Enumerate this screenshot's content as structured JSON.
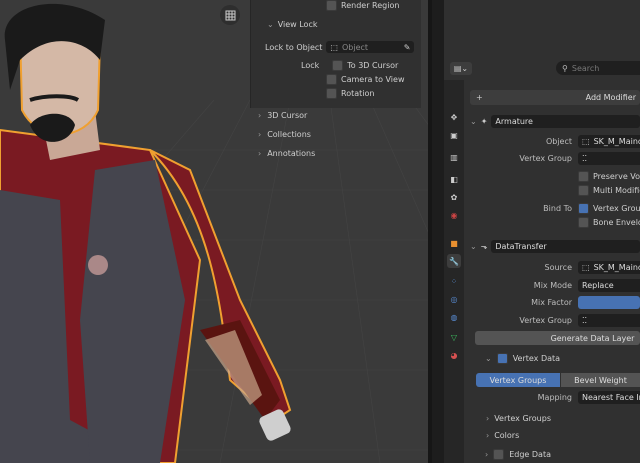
{
  "npanel": {
    "render_region": "Render Region",
    "view_lock_title": "View Lock",
    "lock_to_object_label": "Lock to Object",
    "object_placeholder": "Object",
    "lock_label": "Lock",
    "to_3d_cursor": "To 3D Cursor",
    "camera_to_view": "Camera to View",
    "rotation": "Rotation",
    "sections": [
      "3D Cursor",
      "Collections",
      "Annotations"
    ]
  },
  "properties": {
    "search_placeholder": "Search",
    "add_modifier": "Add Modifier",
    "armature": {
      "name": "Armature",
      "object_label": "Object",
      "object_value": "SK_M_Mainc",
      "vertex_group_label": "Vertex Group",
      "preserve_volume": "Preserve Volu",
      "multi_modifier": "Multi Modifier",
      "bind_to_label": "Bind To",
      "vertex_groups": "Vertex Group",
      "bone_envelopes": "Bone Envelop"
    },
    "datatransfer": {
      "name": "DataTransfer",
      "source_label": "Source",
      "source_value": "SK_M_Mainc",
      "mix_mode_label": "Mix Mode",
      "mix_mode_value": "Replace",
      "mix_factor_label": "Mix Factor",
      "vertex_group_label": "Vertex Group",
      "generate_button": "Generate Data Layer",
      "vertex_data_label": "Vertex Data",
      "tab_vertex_groups": "Vertex Groups",
      "tab_bevel_weight": "Bevel Weight",
      "mapping_label": "Mapping",
      "mapping_value": "Nearest Face In",
      "sub_vertex_groups": "Vertex Groups",
      "sub_colors": "Colors",
      "edge_data": "Edge Data"
    }
  },
  "colors": {
    "accent": "#4772b3",
    "selection_outline": "#f0a030"
  }
}
